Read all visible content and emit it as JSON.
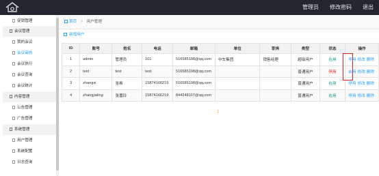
{
  "topnav": [
    "管理员",
    "修改密码",
    "退出"
  ],
  "sidebar": {
    "items": [
      {
        "label": "促销管理",
        "type": "sub"
      },
      {
        "label": "会议管理",
        "type": "group"
      },
      {
        "label": "我的会议",
        "type": "sub"
      },
      {
        "label": "会议审核",
        "type": "sub",
        "active": true
      },
      {
        "label": "会议执行",
        "type": "sub"
      },
      {
        "label": "会议查询",
        "type": "sub"
      },
      {
        "label": "会议统计",
        "type": "sub"
      },
      {
        "label": "内容管理",
        "type": "group"
      },
      {
        "label": "公告管理",
        "type": "sub"
      },
      {
        "label": "广告管理",
        "type": "sub"
      },
      {
        "label": "系统管理",
        "type": "group"
      },
      {
        "label": "用户管理",
        "type": "sub"
      },
      {
        "label": "系统配置",
        "type": "sub"
      },
      {
        "label": "日志查询",
        "type": "sub"
      }
    ]
  },
  "breadcrumb": {
    "home": "首页",
    "separator": ">",
    "current": "用户管理"
  },
  "add_user_label": "新增用户",
  "table": {
    "headers": [
      "ID",
      "账号",
      "姓名",
      "电话",
      "邮箱",
      "单位",
      "职务",
      "类型",
      "状态",
      "操作"
    ],
    "rows": [
      {
        "id": "1",
        "account": "admin",
        "name": "管理员",
        "phone": "101",
        "email": "516585198@qq.com",
        "unit": "中车集团",
        "title": "销售经理",
        "type": "超级用户",
        "status": "在用",
        "status_kind": "on",
        "ops": [
          "停用",
          "修改",
          "删除"
        ]
      },
      {
        "id": "2",
        "account": "test",
        "name": "test",
        "phone": "test",
        "email": "516585198@qq.com",
        "unit": "",
        "title": "",
        "type": "普通用户",
        "status": "停用",
        "status_kind": "off",
        "ops": [
          "启用",
          "修改",
          "删除"
        ]
      },
      {
        "id": "3",
        "account": "zhangxi",
        "name": "张希",
        "phone": "15874166219",
        "email": "516585198@qq.com",
        "unit": "",
        "title": "",
        "type": "普通用户",
        "status": "在用",
        "status_kind": "on",
        "ops": [
          "停用",
          "修改",
          "删除"
        ]
      },
      {
        "id": "4",
        "account": "zhangjialing",
        "name": "张嘉玲",
        "phone": "15874166219",
        "email": "844248107@qq.com",
        "unit": "",
        "title": "",
        "type": "普通用户",
        "status": "在用",
        "status_kind": "on",
        "ops": [
          "停用",
          "修改",
          "删除"
        ]
      }
    ]
  },
  "pager": {
    "current": "1"
  },
  "colors": {
    "topbar": "#23262e",
    "accent": "#1e9fff",
    "on": "#009688",
    "off": "#e02020"
  }
}
